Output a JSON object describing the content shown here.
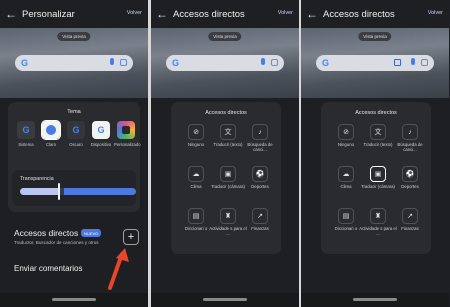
{
  "panel1": {
    "title": "Personalizar",
    "volver": "Volver",
    "vista_previa": "Vista previa",
    "tema": {
      "title": "Tema",
      "options": [
        {
          "label": "Sistema",
          "icon": "google-g-icon",
          "color": "#4285f4"
        },
        {
          "label": "Claro",
          "icon": "google-g-icon",
          "color": "#4285f4",
          "selected": true
        },
        {
          "label": "Oscuro",
          "icon": "google-g-icon",
          "color": "#4285f4"
        },
        {
          "label": "Dispositivo",
          "icon": "google-g-icon",
          "color": "#4285f4"
        },
        {
          "label": "Personalizado",
          "icon": "google-g-icon",
          "color": "#e44c8a"
        }
      ]
    },
    "transparencia": {
      "title": "Transparencia",
      "value_fraction": 0.35
    },
    "accesos": {
      "title": "Accesos directos",
      "badge": "NUEVO",
      "subtitle": "Traductor, Buscador de canciones y otros",
      "add": "+"
    },
    "comentarios": "Enviar comentarios"
  },
  "panel2": {
    "title": "Accesos directos",
    "volver": "Volver",
    "vista_previa": "Vista previa",
    "card_title": "Accesos directos",
    "items": [
      {
        "label": "Ninguno",
        "icon": "no-visibility-icon",
        "glyph": "⊘"
      },
      {
        "label": "Traducir (texto)",
        "icon": "translate-icon",
        "glyph": "文"
      },
      {
        "label": "Búsqueda de canci...",
        "icon": "music-note-icon",
        "glyph": "♪"
      },
      {
        "label": "Clima",
        "icon": "weather-icon",
        "glyph": "☁"
      },
      {
        "label": "Traducir (cámara)",
        "icon": "camera-translate-icon",
        "glyph": "▣"
      },
      {
        "label": "Deportes",
        "icon": "sports-icon",
        "glyph": "⚽"
      },
      {
        "label": "Diccionari o",
        "icon": "dictionary-icon",
        "glyph": "▤"
      },
      {
        "label": "Actividade s para el ...",
        "icon": "school-icon",
        "glyph": "♜"
      },
      {
        "label": "Finanzas",
        "icon": "finance-icon",
        "glyph": "↗"
      }
    ]
  },
  "panel3": {
    "title": "Accesos directos",
    "volver": "Volver",
    "vista_previa": "Vista previa",
    "card_title": "Accesos directos",
    "selected_index": 4
  },
  "accent_color": "#4c78e0",
  "arrow_color": "#e8452c"
}
